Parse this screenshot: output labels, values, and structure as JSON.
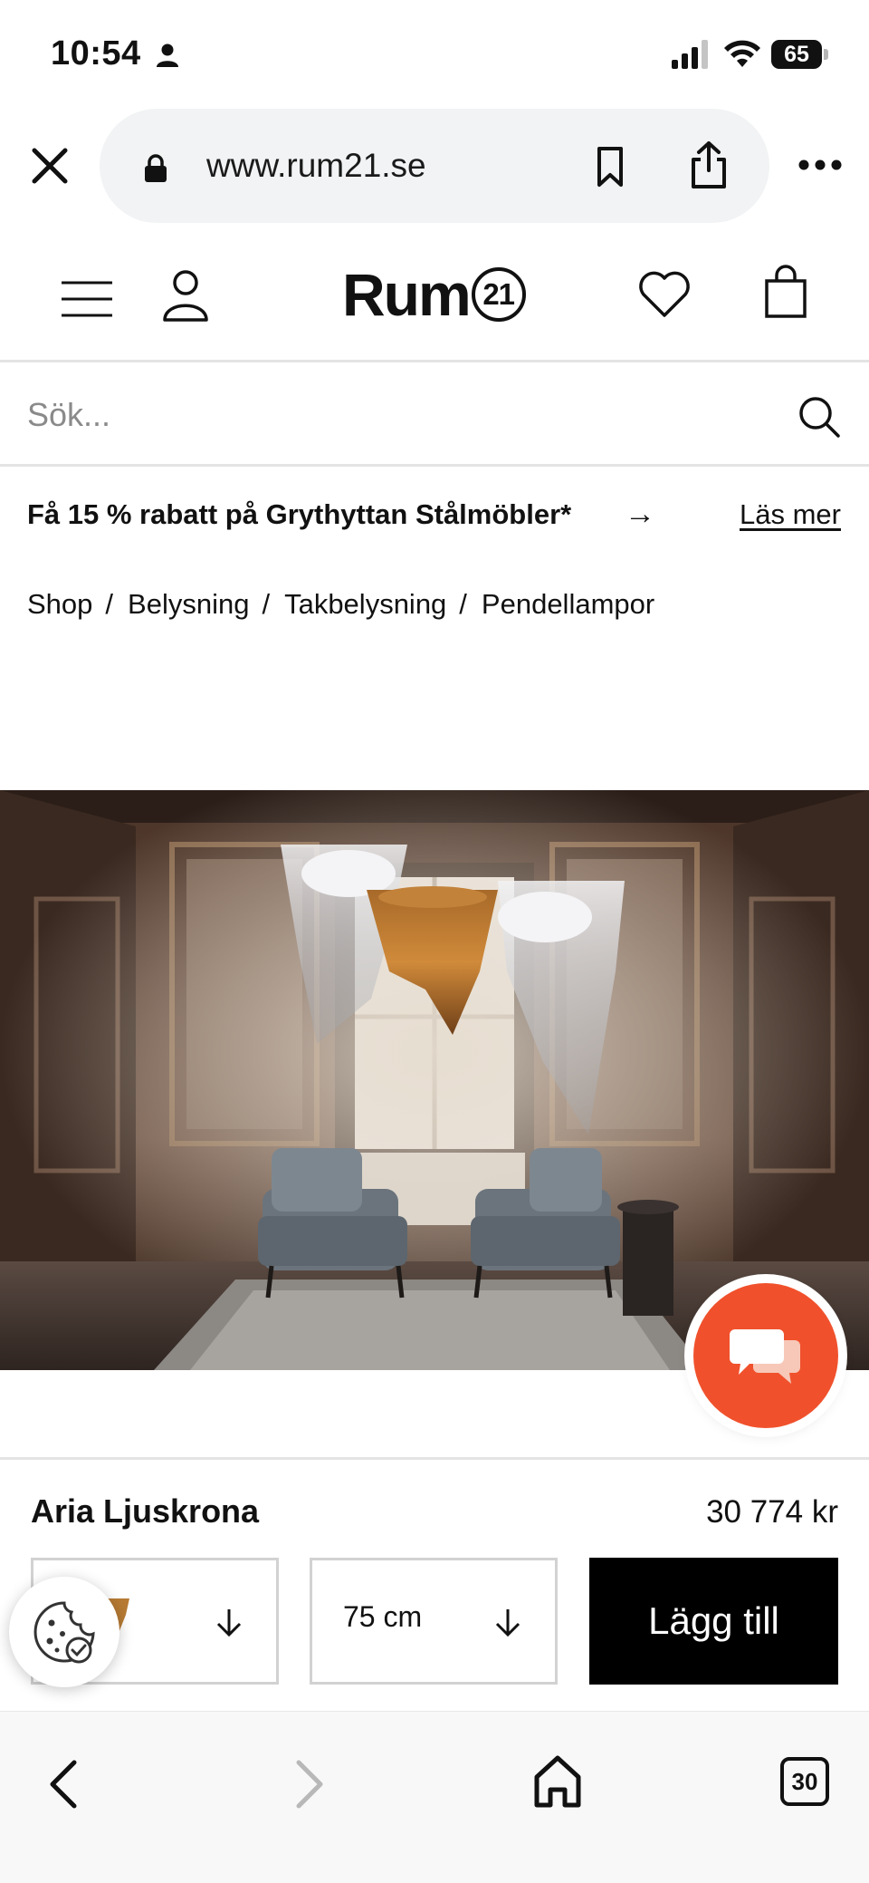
{
  "status_bar": {
    "time": "10:54",
    "battery": "65"
  },
  "browser": {
    "url": "www.rum21.se"
  },
  "site": {
    "logo_text": "Rum",
    "logo_number": "21"
  },
  "search": {
    "placeholder": "Sök..."
  },
  "promo": {
    "text": "Få 15 % rabatt på Grythyttan Stålmöbler*",
    "arrow": "→",
    "link": "Läs mer"
  },
  "breadcrumb": {
    "items": [
      "Shop",
      "Belysning",
      "Takbelysning",
      "Pendellampor"
    ],
    "separator": "/"
  },
  "product": {
    "name": "Aria Ljuskrona",
    "price": "30 774 kr",
    "size_value": "75 cm",
    "add_button": "Lägg till"
  },
  "bottom_nav": {
    "tabs_count": "30"
  },
  "colors": {
    "chat_accent": "#f0512c",
    "button_black": "#000000",
    "url_pill": "#f1f3f4"
  }
}
